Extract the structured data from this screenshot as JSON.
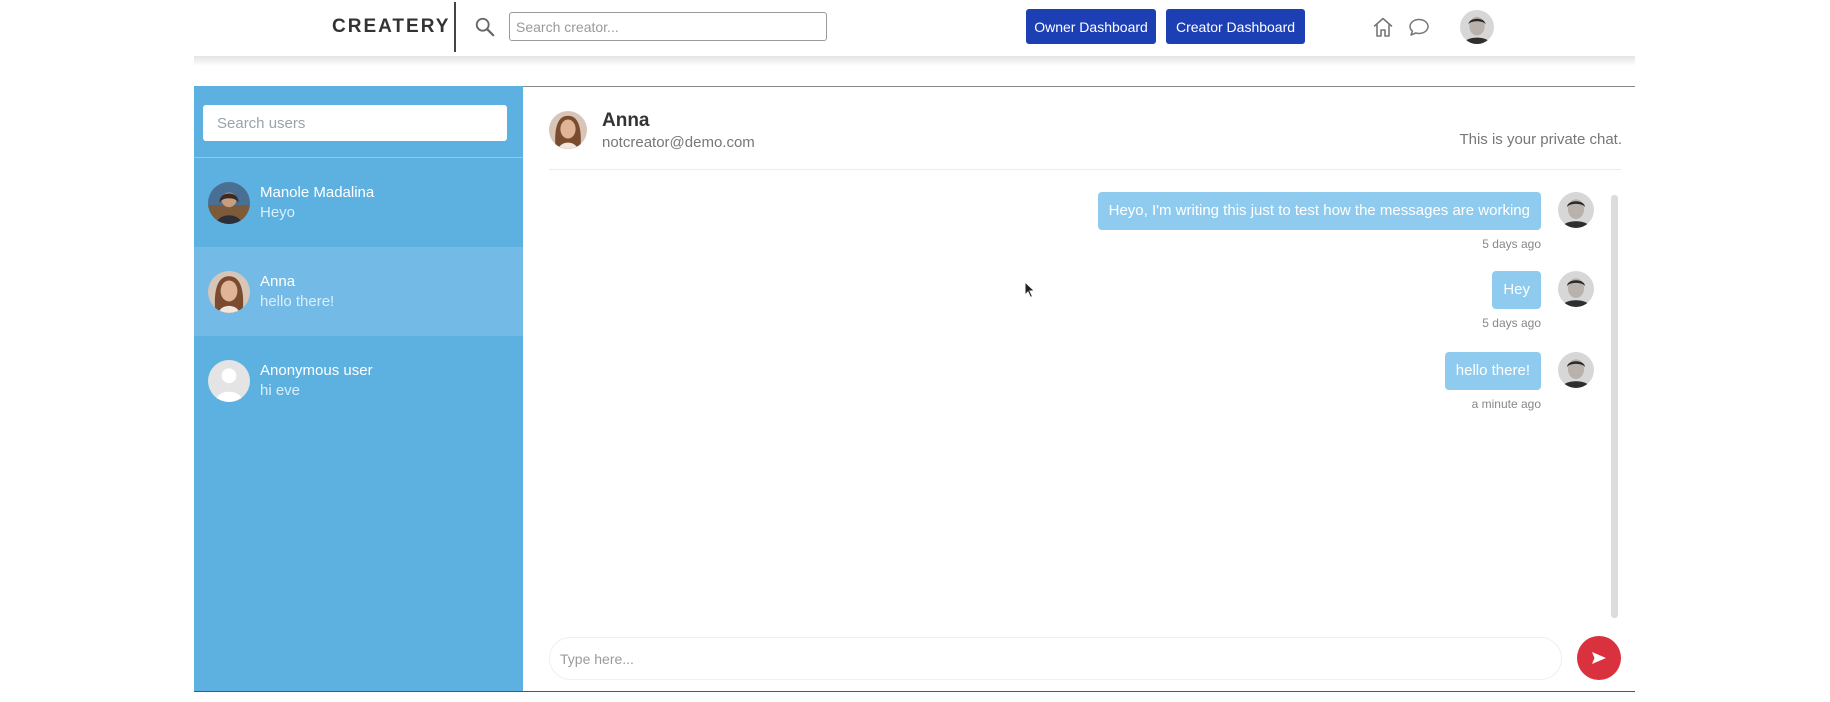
{
  "header": {
    "logo": "CREATERY",
    "search_placeholder": "Search creator...",
    "search_icon": "search-icon",
    "owner_dashboard_label": "Owner Dashboard",
    "creator_dashboard_label": "Creator Dashboard",
    "nav_icons": [
      "home-icon",
      "chat-bubble-icon"
    ],
    "button_color": "#1d3fb4"
  },
  "sidebar": {
    "search_placeholder": "Search users",
    "background_color": "#5db1e0",
    "conversations": [
      {
        "name": "Manole Madalina",
        "last_message": "Heyo",
        "active": false
      },
      {
        "name": "Anna",
        "last_message": "hello there!",
        "active": true
      },
      {
        "name": "Anonymous user",
        "last_message": "hi eve",
        "active": false
      }
    ]
  },
  "chat": {
    "contact_name": "Anna",
    "contact_email": "notcreator@demo.com",
    "note": "This is your private chat.",
    "bubble_color": "#8fcbee",
    "messages": [
      {
        "text": "Heyo, I'm writing this just to test how the messages are working",
        "time": "5 days ago"
      },
      {
        "text": "Hey",
        "time": "5 days ago"
      },
      {
        "text": "hello there!",
        "time": "a minute ago"
      }
    ],
    "compose_placeholder": "Type here...",
    "send_icon": "send-icon",
    "send_color": "#d9313d"
  }
}
